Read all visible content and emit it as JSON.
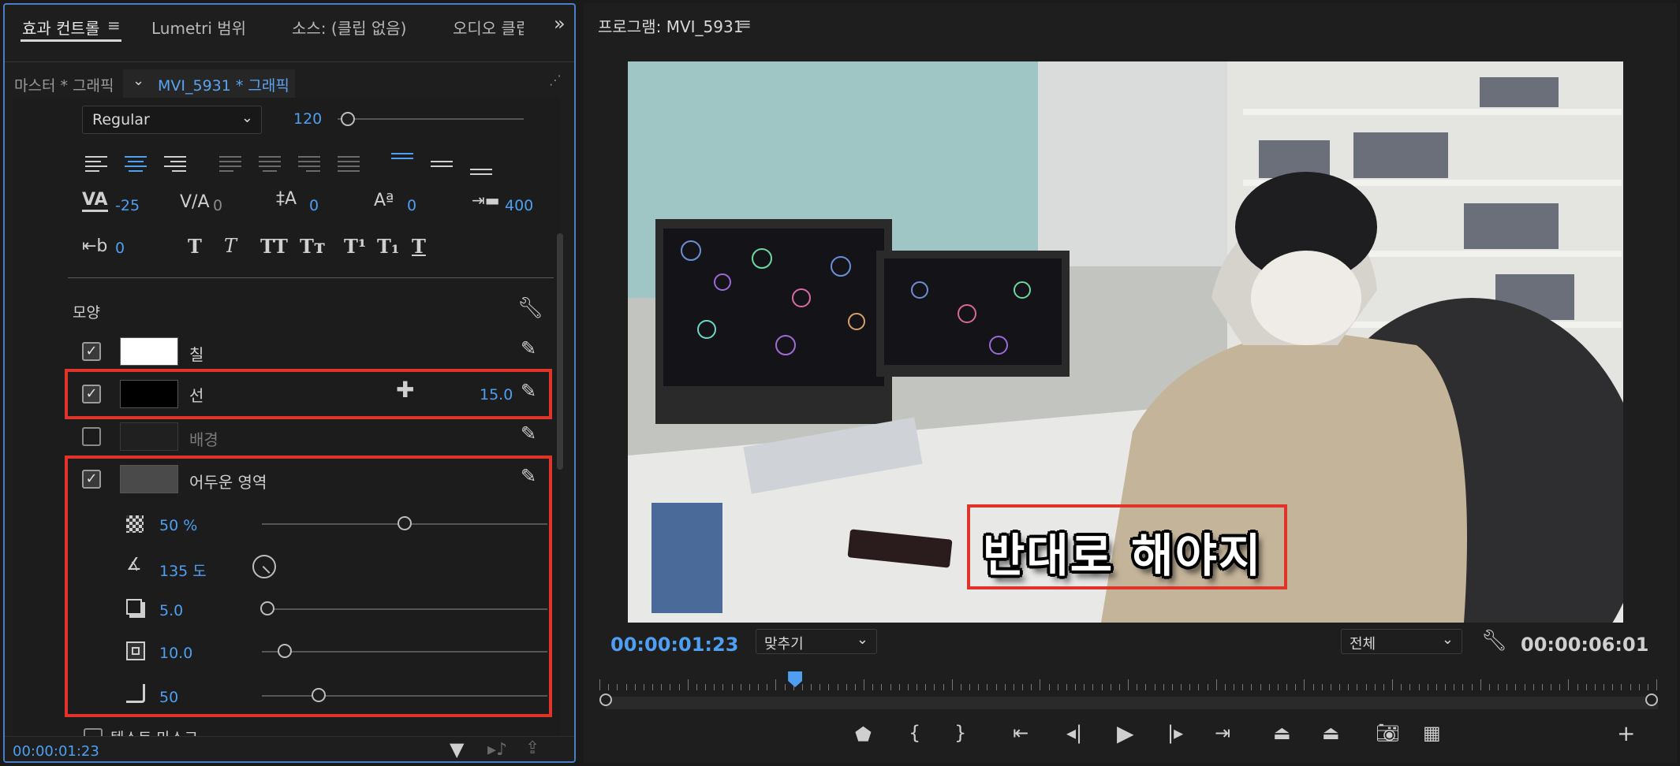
{
  "left_panel": {
    "tabs": [
      "효과 컨트롤",
      "Lumetri 범위",
      "소스: (클립 없음)",
      "오디오 클립"
    ],
    "expand_glyph": "»",
    "master_label": "마스터 * 그래픽",
    "clip_label": "MVI_5931 * 그래픽",
    "font_style": "Regular",
    "font_size": "120",
    "kerning": "-25",
    "tracking": "0",
    "baseline": "0",
    "tsume": "0",
    "leading": "400",
    "tab_width": "0",
    "appearance_heading": "모양",
    "fill_label": "칠",
    "stroke_label": "선",
    "stroke_width": "15.0",
    "background_label": "배경",
    "shadow_label": "어두운 영역",
    "shadow_opacity": "50 %",
    "shadow_angle": "135 도",
    "shadow_distance": "5.0",
    "shadow_size": "10.0",
    "shadow_blur": "50",
    "shadow_opacity_level": 0.5,
    "shadow_distance_level": 0.02,
    "shadow_size_level": 0.08,
    "shadow_blur_level": 0.2,
    "text_mask_label": "텍스트 마스크",
    "timecode": "00:00:01:23",
    "colors": {
      "fill": "#ffffff",
      "stroke": "#000000",
      "accent": "#4e9ff2",
      "highlight": "#e0342a"
    }
  },
  "right_panel": {
    "title": "프로그램: MVI_5931",
    "caption": "반대로 해야지",
    "current_timecode": "00:00:01:23",
    "zoom": "맞추기",
    "quality": "전체",
    "duration": "00:00:06:01",
    "playhead_fraction": 0.18
  }
}
